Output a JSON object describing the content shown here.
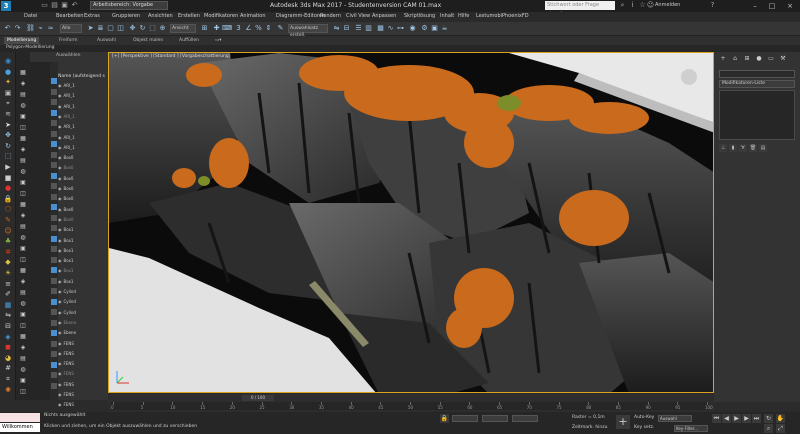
{
  "app": {
    "logo_label": "3",
    "workspace_label": "Arbeitsbereich: Vorgabe",
    "window_title": "Autodesk 3ds Max 2017  -  Studentenversion    CAM 01.max",
    "search_placeholder": "Stichwort oder Frage eingeben",
    "login_label": "Anmelden"
  },
  "menu": [
    "Datei",
    "Bearbeiten",
    "Extras",
    "Gruppieren",
    "Ansichten",
    "Erstellen",
    "Modifikatoren",
    "Animation",
    "Diagramm-Editoren",
    "Rendern",
    "Civil View",
    "Anpassen",
    "Skriptlösung",
    "Inhalt",
    "Hilfe",
    "Lestumobi",
    "PhoenixFD"
  ],
  "toolbar": {
    "filter_select": "Alle",
    "view_select": "Ansicht",
    "selection_set": "Auswahlsatz erstell."
  },
  "ribbon": {
    "tabs": [
      "Modellierung",
      "Freiform",
      "Auswahl",
      "Objekt malen",
      "Auffüllen"
    ],
    "active_tab": "Modellierung",
    "sub_label": "Polygon-Modellierung"
  },
  "scene_explorer": {
    "tab": "Auswählen",
    "header": "Name (aufsteigend s",
    "rows": [
      "ARI_1",
      "ARI_1",
      "ARI_1",
      "ARI_1",
      "ARI_1",
      "ARI_1",
      "ARI_1",
      "Box0",
      "Box0",
      "Box0",
      "Box0",
      "Box0",
      "Box0",
      "Box0",
      "Box1",
      "Box1",
      "Box1",
      "Box1",
      "Box1",
      "Box1",
      "Cylind",
      "Cylind",
      "Cylind",
      "Ebene",
      "Ebene",
      "FENS",
      "FENS",
      "FENS",
      "FENS",
      "FENS",
      "FENS",
      "FENS"
    ]
  },
  "viewport": {
    "label": "[+] [Perspektive ] [Standard ] [Vorgabeschattierung]"
  },
  "command_panel": {
    "modifier_list": "Modifikatoren-Liste"
  },
  "timeline": {
    "frame_counter": "0 / 100",
    "ticks": [
      0,
      5,
      10,
      15,
      20,
      25,
      30,
      35,
      40,
      45,
      50,
      55,
      60,
      65,
      70,
      75,
      80,
      85,
      90,
      95,
      100
    ]
  },
  "status": {
    "maxscript_line": "",
    "maxscript_input": "Willkommen bei",
    "selection_info": "Nichts ausgewählt",
    "prompt": "Klicken und ziehen, um ein Objekt auszuwählen und zu verschieben",
    "grid": "Raster = 0,1m",
    "autokey": "Auto-Key",
    "selection_mode": "Auswahl",
    "set_key": "Key setz.",
    "key_filter": "Key-Filter...",
    "time_tag": "Zeitmark. hinzu"
  },
  "colors": {
    "viewport_border": "#d9a520",
    "foliage": "#c96a1c",
    "rock": "#3a3a3a"
  }
}
